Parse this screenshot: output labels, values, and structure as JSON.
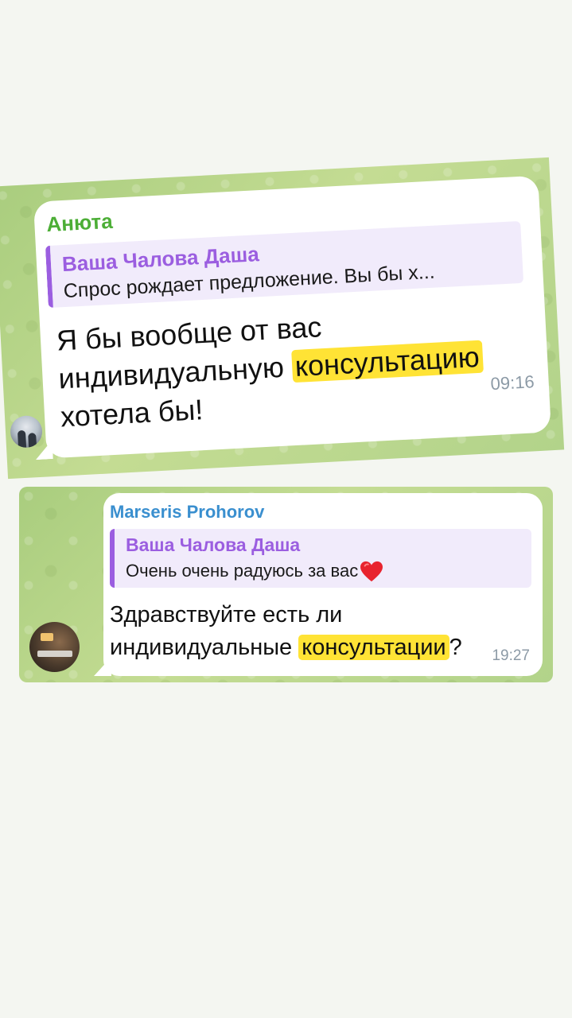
{
  "messages": [
    {
      "sender": "Анюта",
      "sender_color": "#4cae36",
      "avatar_icon": "user-photo-avatar",
      "reply": {
        "name": "Ваша Чалова Даша",
        "text": "Спрос рождает предложение. Вы бы х..."
      },
      "text_parts": [
        "Я бы вообще от вас индивидуальную ",
        "консультацию",
        " хотела бы!"
      ],
      "time": "09:16"
    },
    {
      "sender": "Marseris Prohorov",
      "sender_color": "#3a8fcf",
      "avatar_icon": "user-photo-avatar",
      "reply": {
        "name": "Ваша Чалова Даша",
        "text": "Очень очень радуюсь за вас",
        "emoji": "red-heart-icon"
      },
      "text_parts": [
        "Здравствуйте есть ли индивидуальные ",
        "консультации",
        "?"
      ],
      "time": "19:27"
    }
  ],
  "colors": {
    "highlight": "#ffe335",
    "reply_accent": "#9b5ee0",
    "chat_background": "#b8d488",
    "page_background": "#f4f6f1"
  }
}
